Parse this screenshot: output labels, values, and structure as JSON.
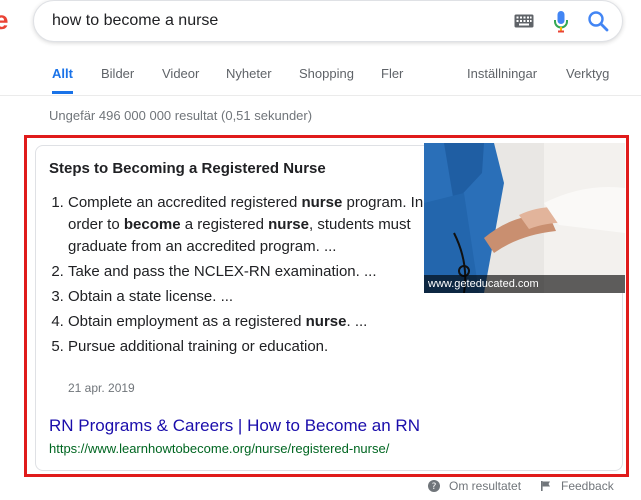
{
  "search": {
    "query": "how to become a nurse"
  },
  "tabs": [
    {
      "label": "Allt"
    },
    {
      "label": "Bilder"
    },
    {
      "label": "Videor"
    },
    {
      "label": "Nyheter"
    },
    {
      "label": "Shopping"
    },
    {
      "label": "Fler"
    },
    {
      "label": "Inställningar"
    },
    {
      "label": "Verktyg"
    }
  ],
  "result_stats": "Ungefär 496 000 000 resultat (0,51 sekunder)",
  "snippet": {
    "title": "Steps to Becoming a Registered Nurse",
    "steps": [
      {
        "parts": [
          "Complete an accredited registered ",
          "nurse",
          " program. In order to ",
          "become",
          " a registered ",
          "nurse",
          ", students must graduate from an accredited program. ..."
        ]
      },
      {
        "parts": [
          "Take and pass the NCLEX-RN examination. ..."
        ]
      },
      {
        "parts": [
          "Obtain a state license. ..."
        ]
      },
      {
        "parts": [
          "Obtain employment as a registered ",
          "nurse",
          ". ..."
        ]
      },
      {
        "parts": [
          "Pursue additional training or education."
        ]
      }
    ],
    "date": "21 apr. 2019",
    "image_caption": "www.geteducated.com"
  },
  "result": {
    "title": "RN Programs & Careers | How to Become an RN",
    "url": "https://www.learnhowtobecome.org/nurse/registered-nurse/"
  },
  "footer": {
    "about": "Om resultatet",
    "feedback": "Feedback"
  },
  "colors": {
    "accent": "#1a73e8",
    "link": "#1a0dab",
    "url": "#006621",
    "highlight": "#e01b1b"
  }
}
